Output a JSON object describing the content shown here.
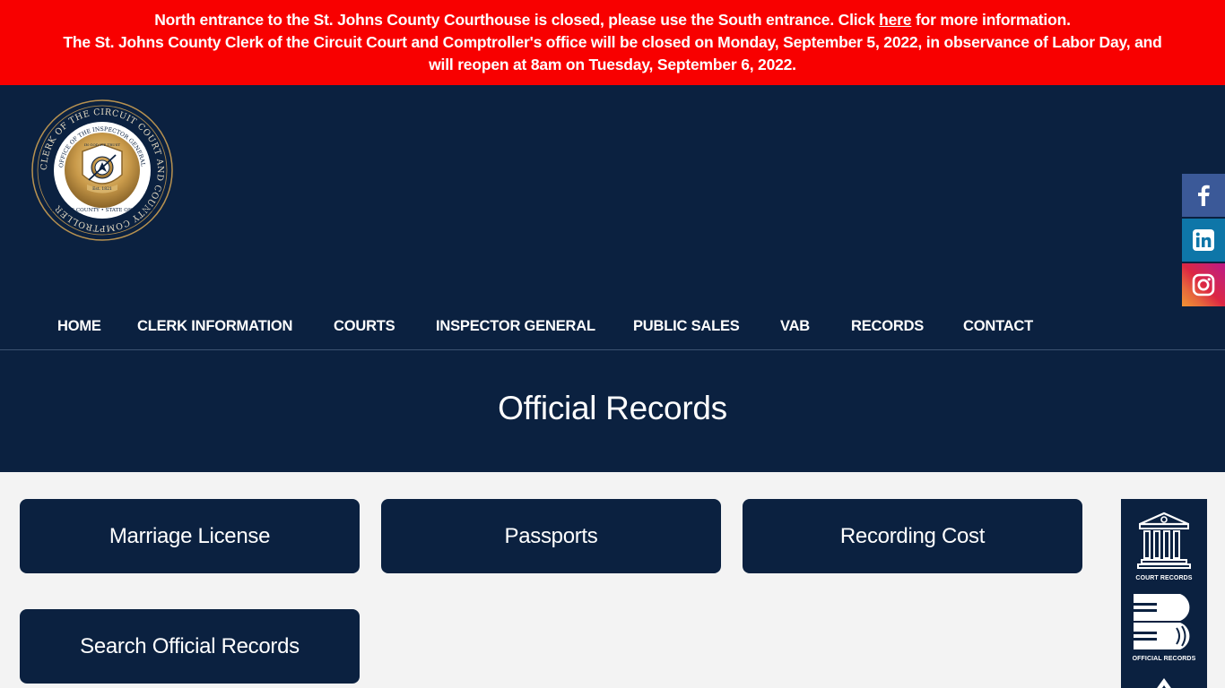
{
  "alert": {
    "line1_before": "North entrance to the St. Johns County Courthouse is closed, please use the South entrance. Click ",
    "line1_link": "here",
    "line1_after": " for more information.",
    "line2": "The St. Johns County Clerk of the Circuit Court and Comptroller's office will be closed on Monday, September 5, 2022, in observance of Labor Day, and",
    "line3": "will reopen at 8am on Tuesday, September 6, 2022.",
    "background_color": "#f80000"
  },
  "logo": {
    "outer_text": "CLERK OF THE CIRCUIT COURT AND COUNTY COMPTROLLER",
    "inner_text": "OFFICE OF THE INSPECTOR GENERAL",
    "motto": "IN GOD WE TRUST",
    "bottom_left": "ST. JOHNS COUNTY",
    "bottom_right": "STATE OF FLORIDA",
    "established": "Est. 1821"
  },
  "social": [
    {
      "name": "facebook",
      "icon": "facebook-icon"
    },
    {
      "name": "linkedin",
      "icon": "linkedin-icon"
    },
    {
      "name": "instagram",
      "icon": "instagram-icon"
    }
  ],
  "nav": {
    "items": [
      {
        "label": "HOME"
      },
      {
        "label": "CLERK INFORMATION"
      },
      {
        "label": "COURTS"
      },
      {
        "label": "INSPECTOR GENERAL"
      },
      {
        "label": "PUBLIC SALES"
      },
      {
        "label": "VAB"
      },
      {
        "label": "RECORDS"
      },
      {
        "label": "CONTACT"
      }
    ]
  },
  "page": {
    "title": "Official Records"
  },
  "buttons": [
    {
      "label": "Marriage License"
    },
    {
      "label": "Passports"
    },
    {
      "label": "Recording Cost"
    },
    {
      "label": "Search Official Records"
    }
  ],
  "side_panel": {
    "items": [
      {
        "label": "COURT RECORDS",
        "icon": "courthouse-icon"
      },
      {
        "label": "OFFICIAL RECORDS",
        "icon": "books-icon"
      }
    ]
  },
  "colors": {
    "navy": "#0b2140",
    "page_bg": "#f3f3f3"
  }
}
